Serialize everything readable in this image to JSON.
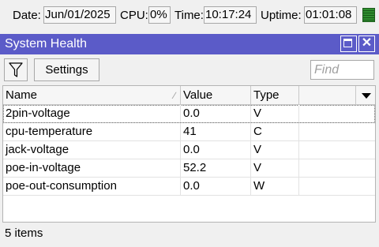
{
  "statusbar": {
    "date_label": "Date:",
    "date_value": "Jun/01/2025",
    "cpu_label": "CPU:",
    "cpu_value": "0%",
    "time_label": "Time:",
    "time_value": "10:17:24",
    "uptime_label": "Uptime:",
    "uptime_value": "01:01:08",
    "meter_color": "#2f8f2f"
  },
  "window": {
    "title": "System Health",
    "title_bar_color": "#5b5bc8"
  },
  "toolbar": {
    "filter_icon": "filter-icon",
    "settings_label": "Settings",
    "find_placeholder": "Find"
  },
  "table": {
    "columns": [
      "Name",
      "Value",
      "Type"
    ],
    "rows": [
      {
        "name": "2pin-voltage",
        "value": "0.0",
        "type": "V"
      },
      {
        "name": "cpu-temperature",
        "value": "41",
        "type": "C"
      },
      {
        "name": "jack-voltage",
        "value": "0.0",
        "type": "V"
      },
      {
        "name": "poe-in-voltage",
        "value": "52.2",
        "type": "V"
      },
      {
        "name": "poe-out-consumption",
        "value": "0.0",
        "type": "W"
      }
    ]
  },
  "footer": {
    "count_text": "5 items"
  }
}
